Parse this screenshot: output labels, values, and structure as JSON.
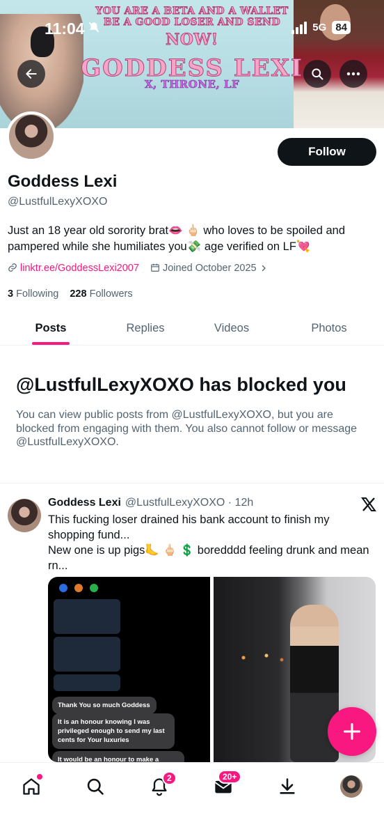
{
  "status_bar": {
    "time": "11:04",
    "network": "5G",
    "battery": "84"
  },
  "banner": {
    "line1": "YOU ARE A BETA AND A WALLET",
    "line2": "BE A GOOD LOSER AND SEND",
    "line3": "NOW!",
    "title": "GODDESS LEXI",
    "subtitle": "X, THRONE, LF"
  },
  "profile": {
    "follow_label": "Follow",
    "name": "Goddess Lexi",
    "handle": "@LustfulLexyXOXO",
    "bio": "Just an 18 year old sorority brat👄 🖕🏻 who loves to be spoiled and pampered while she humiliates you💸 age verified on LF💘",
    "link": "linktr.ee/GoddessLexi2007",
    "joined": "Joined October 2025",
    "following_count": "3",
    "following_label": "Following",
    "followers_count": "228",
    "followers_label": "Followers"
  },
  "tabs": [
    "Posts",
    "Replies",
    "Videos",
    "Photos"
  ],
  "blocked": {
    "title": "@LustfulLexyXOXO has blocked you",
    "message": "You can view public posts from @LustfulLexyXOXO, but you are blocked from engaging with them. You also cannot follow or message @LustfulLexyXOXO."
  },
  "post": {
    "name": "Goddess Lexi",
    "handle_time": "@LustfulLexyXOXO · 12h",
    "text": "This fucking loser drained his bank account to finish my shopping fund...\nNew one is up pigs🦶 🖕🏻 💲 boredddd feeling drunk and mean rn...",
    "media_chat": [
      "Thank You so much Goddess",
      "It is an honour knowing I was privileged enough to send my last cents for Your luxuries",
      "It would be an honour to make a"
    ]
  },
  "bottom_nav": {
    "notifications_badge": "2",
    "messages_badge": "20+"
  },
  "colors": {
    "accent": "#f91880",
    "text_primary": "#0f1419",
    "text_secondary": "#536471"
  }
}
